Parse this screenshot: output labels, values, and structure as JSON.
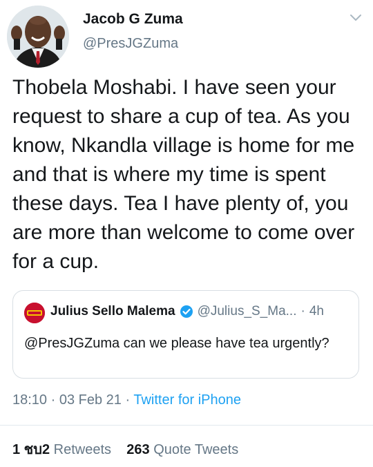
{
  "author": {
    "display_name": "Jacob G Zuma",
    "handle": "@PresJGZuma"
  },
  "tweet": {
    "text": "Thobela Moshabi. I have seen your request to share a cup of tea. As you know, Nkandla village is home for me and that is where my time is spent these days. Tea I have plenty of, you are more than welcome to come over for a cup."
  },
  "quoted_tweet": {
    "display_name": "Julius Sello Malema",
    "handle": "@Julius_S_Ma...",
    "separator": "·",
    "time": "4h",
    "text": "@PresJGZuma can we please have tea urgently?"
  },
  "meta": {
    "time": "18:10",
    "separator": "·",
    "date": "03 Feb 21",
    "source": "Twitter for iPhone"
  },
  "stats": {
    "retweets_count": "1 ชบ2",
    "retweets_label": "Retweets",
    "quotes_count": "263",
    "quotes_label": "Quote Tweets"
  },
  "colors": {
    "text_primary": "#14171a",
    "text_secondary": "#657786",
    "accent": "#1da1f2",
    "border": "#d8dee3",
    "quoted_avatar_bg": "#c8102e"
  },
  "icons": {
    "menu": "chevron-down-icon",
    "verified": "verified-badge-icon"
  }
}
